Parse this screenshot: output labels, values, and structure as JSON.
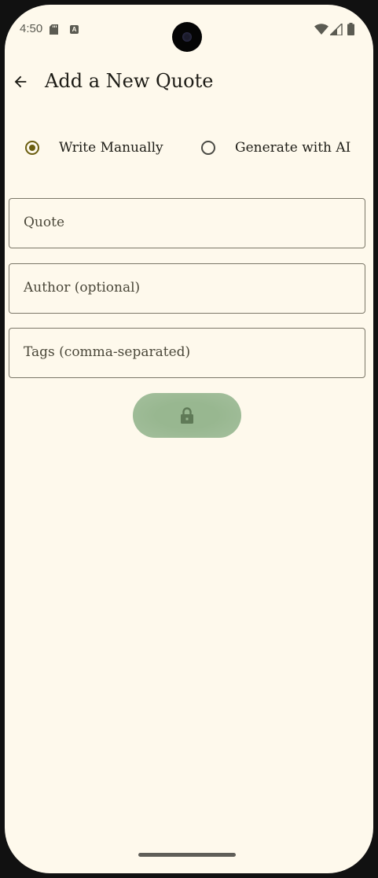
{
  "status_bar": {
    "time": "4:50",
    "icons": [
      "sd-card-icon",
      "a-notification-icon",
      "wifi-icon",
      "signal-icon",
      "battery-icon"
    ],
    "a_badge": "A"
  },
  "app_bar": {
    "back_icon": "arrow-back-icon",
    "title": "Add a New Quote"
  },
  "mode": {
    "options": [
      {
        "label": "Write Manually",
        "selected": true
      },
      {
        "label": "Generate with AI",
        "selected": false
      }
    ]
  },
  "form": {
    "quote_placeholder": "Quote",
    "author_placeholder": "Author (optional)",
    "tags_placeholder": "Tags (comma-separated)"
  },
  "submit": {
    "icon": "lock-icon",
    "state": "disabled"
  },
  "colors": {
    "background": "#FEF9EC",
    "accent": "#6b5e10",
    "button": "#98b790",
    "outline": "#7b7768"
  }
}
